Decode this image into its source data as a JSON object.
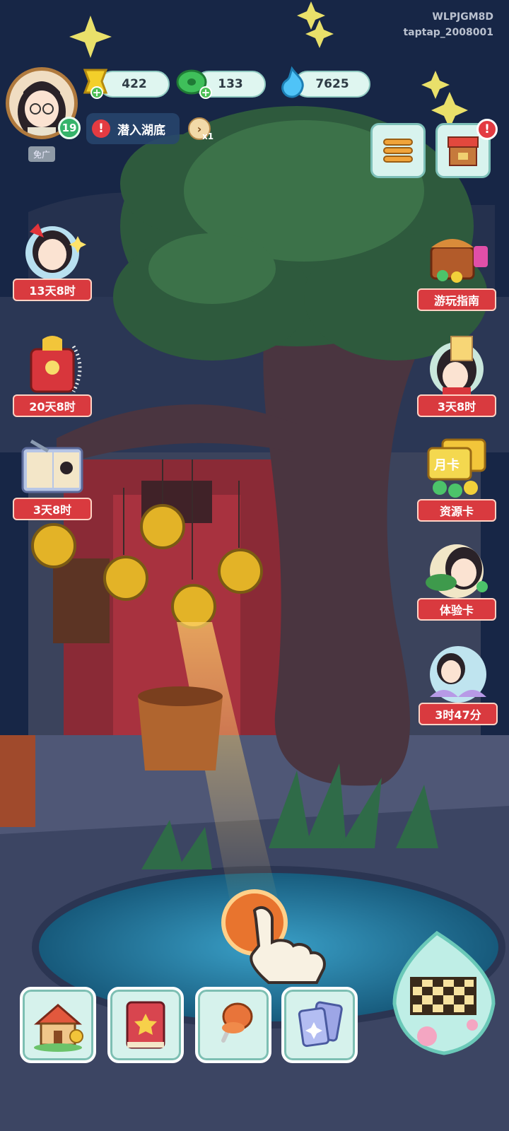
{
  "corner": {
    "code": "WLPJGM8D",
    "channel": "taptap_2008001"
  },
  "player": {
    "level": "19",
    "ad_free": "免广"
  },
  "resources": [
    {
      "name": "gold-bar",
      "value": "422"
    },
    {
      "name": "jade-coin",
      "value": "133"
    },
    {
      "name": "blue-flame",
      "value": "7625"
    }
  ],
  "quest": {
    "label": "潜入湖底",
    "alert": "!",
    "scroll_count": "x1"
  },
  "right_dot": "!",
  "events_left": [
    {
      "label": "13天8时"
    },
    {
      "label": "20天8时"
    },
    {
      "label": "3天8时"
    }
  ],
  "events_right": [
    {
      "label": "游玩指南"
    },
    {
      "label": "3天8时"
    },
    {
      "label": "资源卡",
      "card_text": "月卡"
    },
    {
      "label": "体验卡"
    },
    {
      "label": "3时47分"
    }
  ],
  "icons": [
    "menu-icon",
    "shop-icon",
    "home-icon",
    "book-icon",
    "pushpin-icon",
    "cards-icon",
    "board-icon"
  ],
  "colors": {
    "accent": "#d93a3f",
    "panel": "#d6f2ec",
    "night": "#172646"
  }
}
